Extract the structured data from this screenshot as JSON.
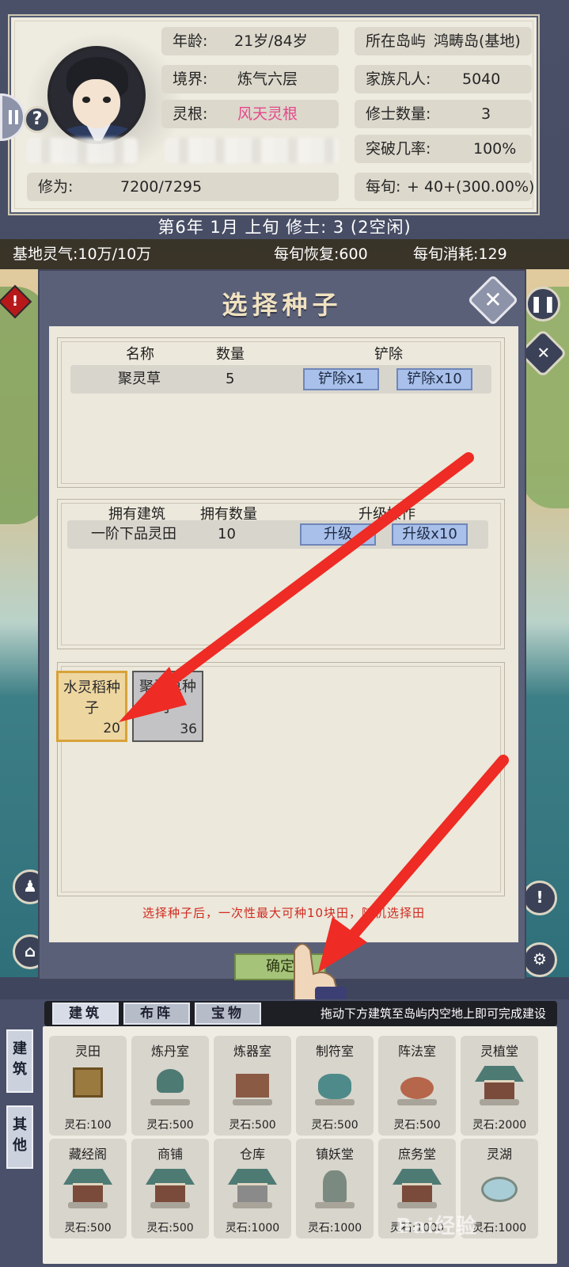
{
  "profile": {
    "age_label": "年龄:",
    "age_value": "21岁/84岁",
    "island_label": "所在岛屿",
    "island_value": "鸿畴岛(基地)",
    "realm_label": "境界:",
    "realm_value": "炼气六层",
    "family_label": "家族凡人:",
    "family_value": "5040",
    "root_label": "灵根:",
    "root_value": "风天灵根",
    "cultivators_label": "修士数量:",
    "cultivators_value": "3",
    "breakthrough_label": "突破几率:",
    "breakthrough_value": "100%",
    "cultivation_label": "修为:",
    "cultivation_value": "7200/7295",
    "per_turn_label": "每旬:",
    "per_turn_value": "+ 40+(300.00%)",
    "help_glyph": "?"
  },
  "date_bar": "第6年 1月 上旬  修士: 3 (2空闲)",
  "spirit": {
    "base_label": "基地灵气:",
    "base_value": "10万/10万",
    "recover_label": "每旬恢复:",
    "recover_value": "600",
    "consume_label": "每旬消耗:",
    "consume_value": "129"
  },
  "dialog": {
    "title": "选择种子",
    "crops": {
      "headers": {
        "name": "名称",
        "count": "数量",
        "remove": "铲除"
      },
      "rows": [
        {
          "name": "聚灵草",
          "count": "5",
          "remove_1": "铲除x1",
          "remove_10": "铲除x10"
        }
      ]
    },
    "buildings": {
      "headers": {
        "name": "拥有建筑",
        "count": "拥有数量",
        "op": "升级操作"
      },
      "rows": [
        {
          "name": "一阶下品灵田",
          "count": "10",
          "up_1": "升级",
          "up_10": "升级x10"
        }
      ]
    },
    "seeds": [
      {
        "name": "水灵稻种子",
        "count": "20",
        "selected": true
      },
      {
        "name": "聚灵草种子",
        "count": "36",
        "selected": false
      }
    ],
    "tip": "选择种子后，一次性最大可种10块田，随机选择田",
    "confirm": "确定"
  },
  "build_panel": {
    "tabs": [
      "建筑",
      "布阵",
      "宝物"
    ],
    "hint": "拖动下方建筑至岛屿内空地上即可完成建设",
    "side_tabs": [
      "建筑",
      "其他"
    ],
    "items": [
      {
        "name": "灵田",
        "price": "灵石:100"
      },
      {
        "name": "炼丹室",
        "price": "灵石:500"
      },
      {
        "name": "炼器室",
        "price": "灵石:500"
      },
      {
        "name": "制符室",
        "price": "灵石:500"
      },
      {
        "name": "阵法室",
        "price": "灵石:500"
      },
      {
        "name": "灵植堂",
        "price": "灵石:2000"
      },
      {
        "name": "藏经阁",
        "price": "灵石:500"
      },
      {
        "name": "商铺",
        "price": "灵石:500"
      },
      {
        "name": "仓库",
        "price": "灵石:1000"
      },
      {
        "name": "镇妖堂",
        "price": "灵石:1000"
      },
      {
        "name": "庶务堂",
        "price": "灵石:1000"
      },
      {
        "name": "灵湖",
        "price": "灵石:1000"
      }
    ]
  },
  "colors": {
    "accent_pink": "#e4488a",
    "tip_red": "#d02a20",
    "arrow_red": "#ee2b24"
  },
  "watermark": "Bai经验"
}
